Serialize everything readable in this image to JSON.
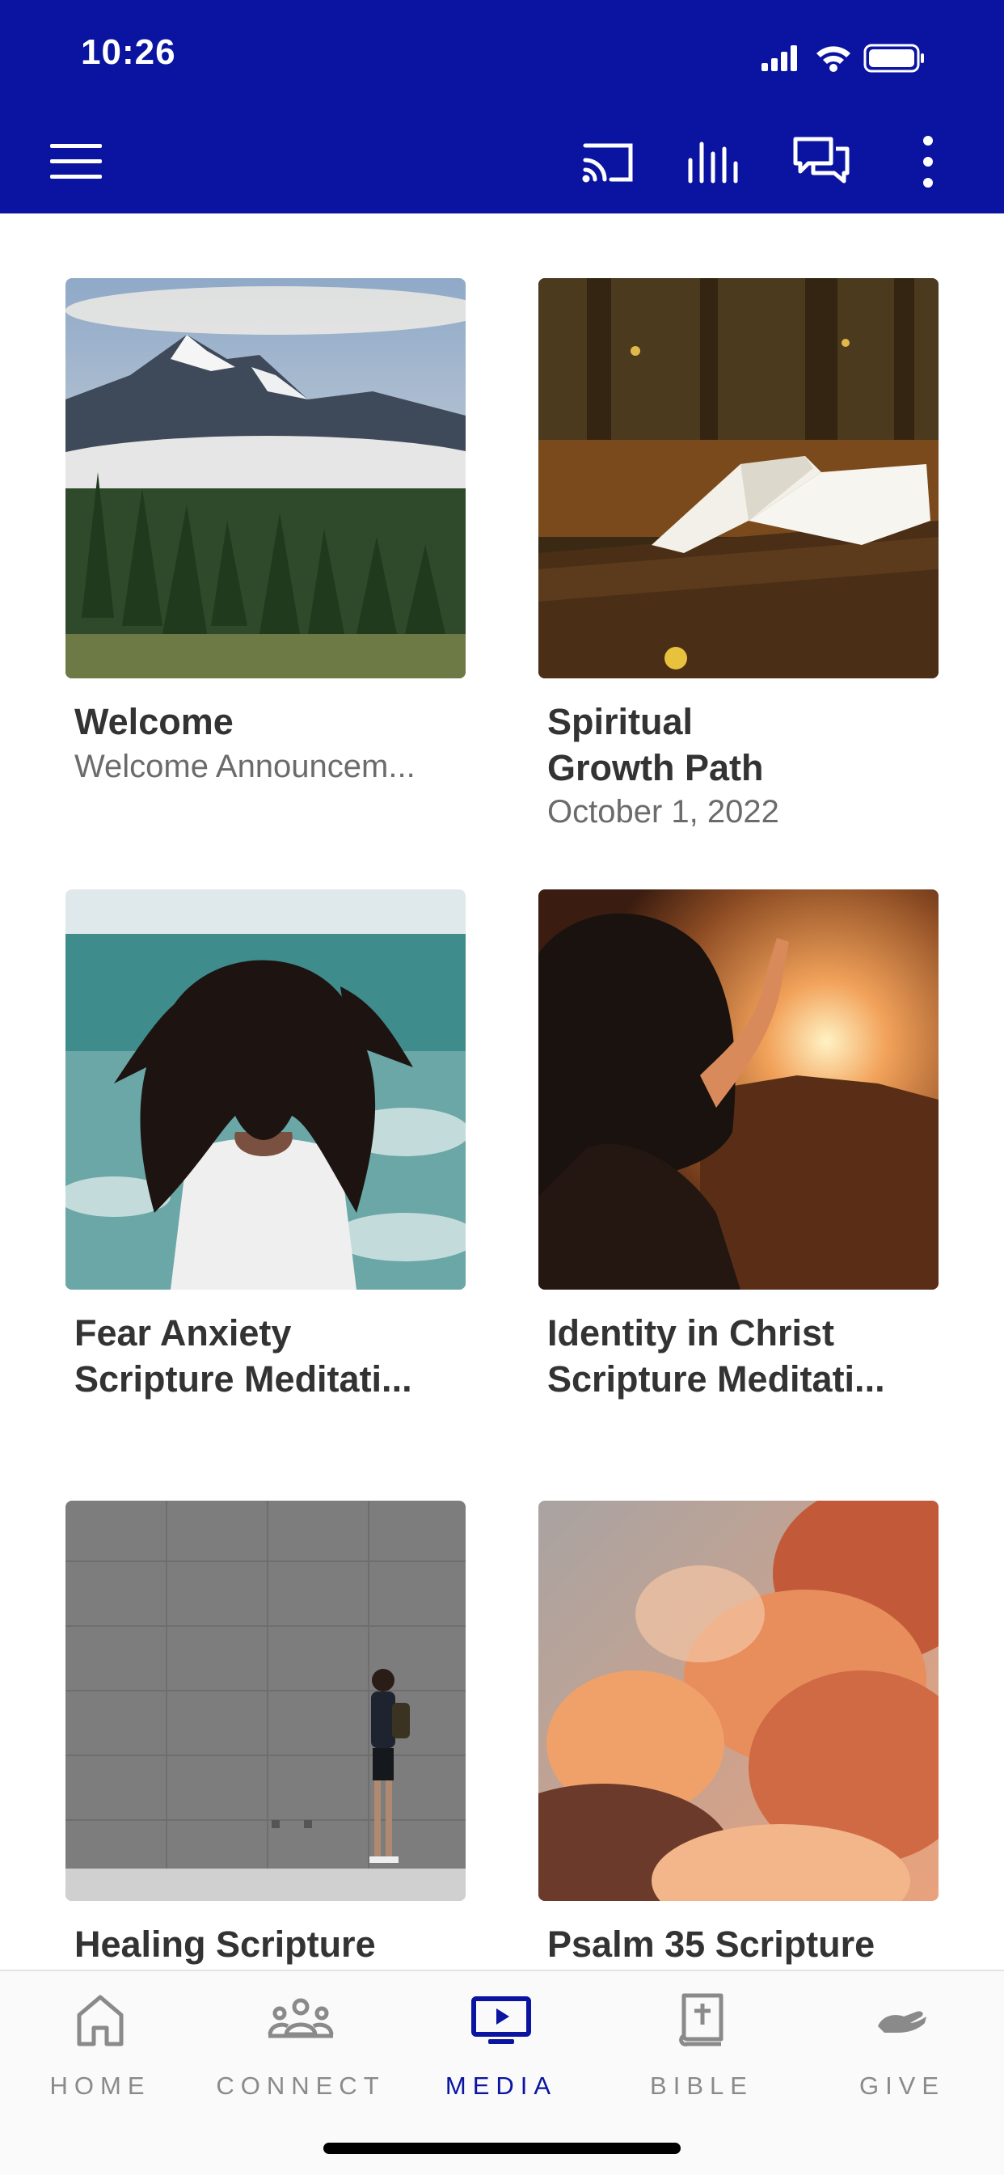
{
  "status_bar": {
    "time": "10:26"
  },
  "toolbar": {
    "menu_icon": "hamburger-menu-icon",
    "actions": [
      "cast-icon",
      "audio-bars-icon",
      "chat-icon",
      "more-vertical-icon"
    ]
  },
  "cards": [
    {
      "title": "Welcome",
      "subtitle": "Welcome Announcem...",
      "image": "mountain-forest"
    },
    {
      "title": "Spiritual\nGrowth Path",
      "subtitle": "October 1, 2022",
      "image": "bible-on-log"
    },
    {
      "title": "Fear Anxiety\nScripture Meditati...",
      "subtitle": "",
      "image": "woman-ocean-hair"
    },
    {
      "title": "Identity in Christ\nScripture Meditati...",
      "subtitle": "",
      "image": "woman-sunset"
    },
    {
      "title": "Healing Scripture",
      "subtitle": "",
      "image": "man-concrete-wall"
    },
    {
      "title": "Psalm 35 Scripture",
      "subtitle": "",
      "image": "orange-clouds"
    }
  ],
  "tabs": [
    {
      "label": "HOME",
      "icon": "home-icon"
    },
    {
      "label": "CONNECT",
      "icon": "people-icon"
    },
    {
      "label": "MEDIA",
      "icon": "media-player-icon"
    },
    {
      "label": "BIBLE",
      "icon": "bible-icon"
    },
    {
      "label": "GIVE",
      "icon": "give-hand-icon"
    }
  ],
  "active_tab": "MEDIA",
  "colors": {
    "brand": "#0a14a0",
    "tab_inactive": "#8a8a8a"
  }
}
